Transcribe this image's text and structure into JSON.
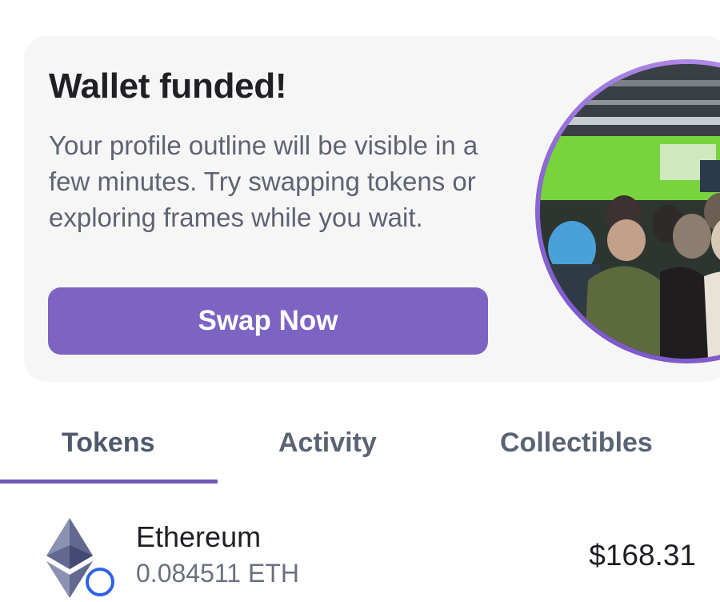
{
  "promo": {
    "title": "Wallet funded!",
    "body": "Your profile outline will be visible in a few minutes. Try swapping tokens or exploring frames while you wait.",
    "button_label": "Swap Now",
    "accent_color": "#7d63c2"
  },
  "tabs": {
    "items": [
      {
        "label": "Tokens",
        "active": true
      },
      {
        "label": "Activity",
        "active": false
      },
      {
        "label": "Collectibles",
        "active": false
      }
    ],
    "indicator_color": "#6f59b8"
  },
  "tokens": [
    {
      "name": "Ethereum",
      "amount": "0.084511 ETH",
      "value": "$168.31",
      "icon": "ethereum-icon",
      "badge_icon": "chain-badge-icon"
    }
  ]
}
